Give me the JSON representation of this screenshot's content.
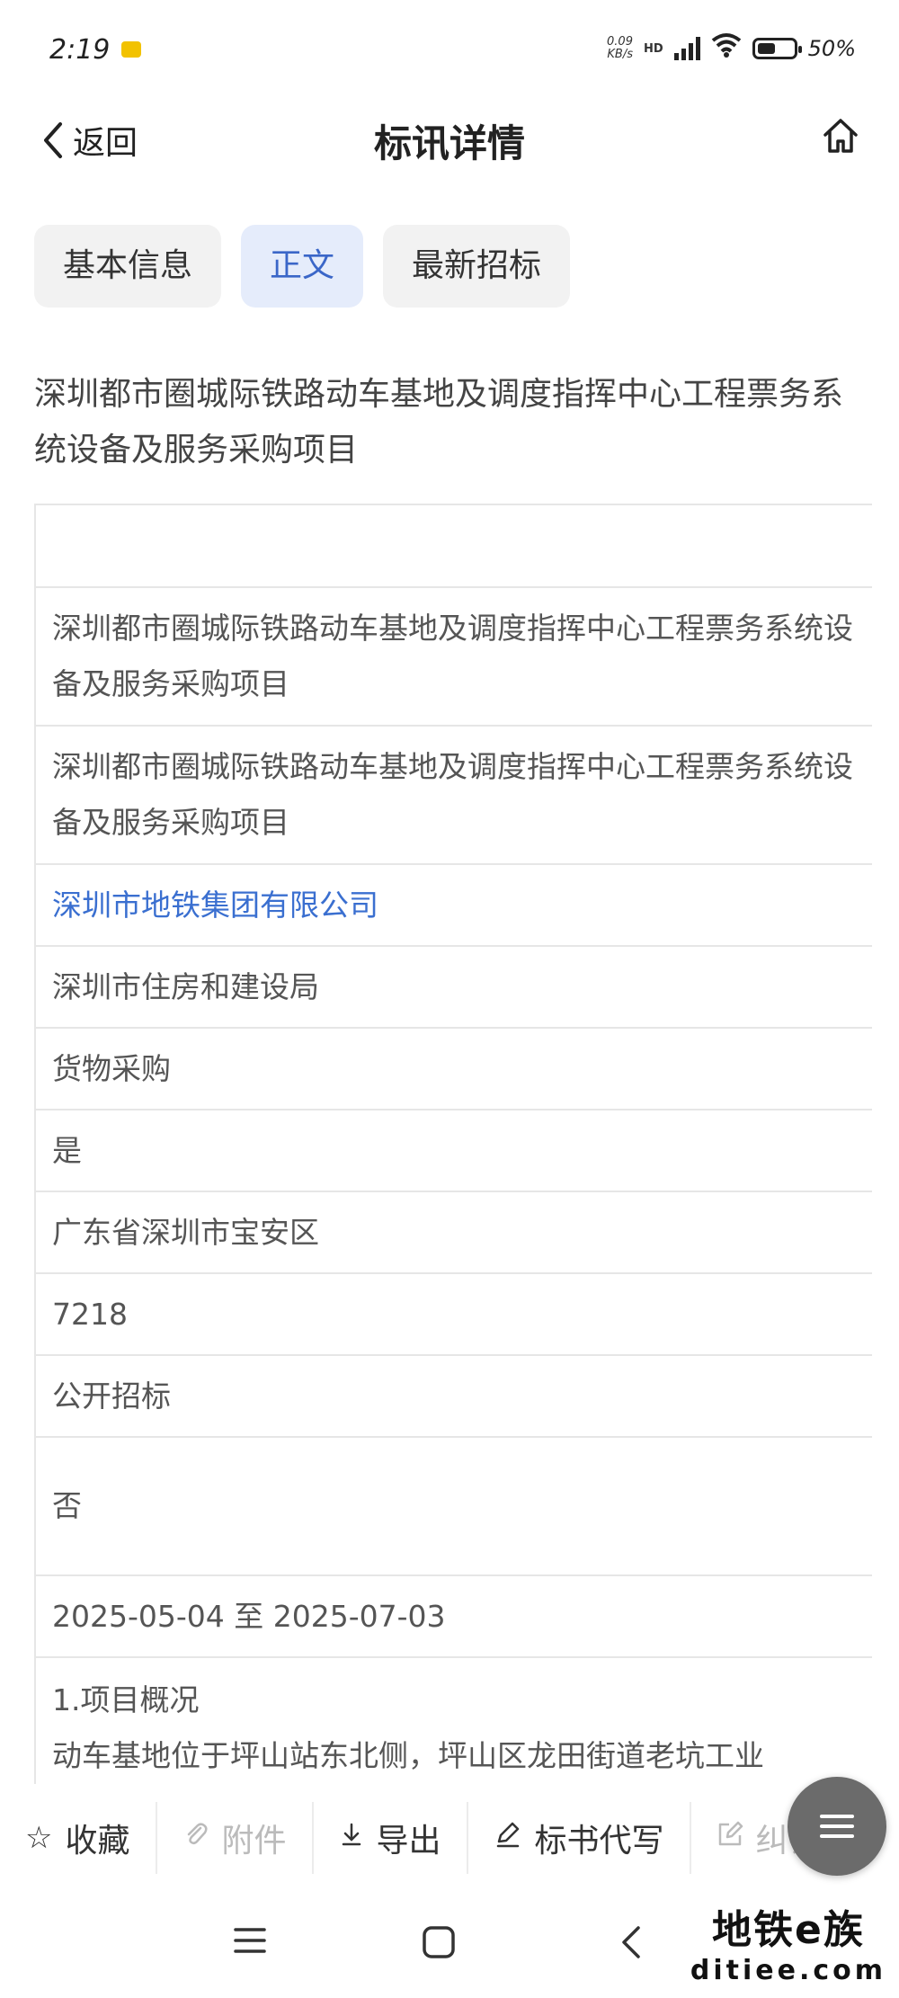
{
  "status_bar": {
    "time": "2:19",
    "speed_value": "0.09",
    "speed_unit": "KB/s",
    "network": "HD",
    "battery_percent": "50%",
    "battery_level": 0.5
  },
  "nav": {
    "back_label": "返回",
    "title": "标讯详情"
  },
  "tabs": [
    {
      "label": "基本信息",
      "active": false
    },
    {
      "label": "正文",
      "active": true
    },
    {
      "label": "最新招标",
      "active": false
    }
  ],
  "headline": "深圳都市圈城际铁路动车基地及调度指挥中心工程票务系统设备及服务采购项目",
  "table_rows": [
    {
      "value": "",
      "link": false
    },
    {
      "value": "深圳都市圈城际铁路动车基地及调度指挥中心工程票务系统设备及服务采购项目",
      "link": false
    },
    {
      "value": "深圳都市圈城际铁路动车基地及调度指挥中心工程票务系统设备及服务采购项目",
      "link": false
    },
    {
      "value": "深圳市地铁集团有限公司",
      "link": true
    },
    {
      "value": "深圳市住房和建设局",
      "link": false
    },
    {
      "value": "货物采购",
      "link": false
    },
    {
      "value": "是",
      "link": false
    },
    {
      "value": "广东省深圳市宝安区",
      "link": false
    },
    {
      "value": "7218",
      "link": false
    },
    {
      "value": "公开招标",
      "link": false
    },
    {
      "value": "否",
      "link": false
    },
    {
      "value": "2025-05-04 至 2025-07-03",
      "link": false
    },
    {
      "value": "1.项目概况\n动车基地位于坪山站东北侧，坪山区龙田街道老坑工业",
      "link": false
    }
  ],
  "bottom_bar": {
    "favorite": "收藏",
    "attachment": "附件",
    "export": "导出",
    "bid_writing": "标书代写",
    "correction_partial": "纠错"
  },
  "watermark": {
    "line1": "地铁e族",
    "line2": "ditiee.com"
  },
  "colors": {
    "accent": "#3a66c8",
    "tab_active_bg": "#e5ecfb",
    "link": "#3a6fd0"
  }
}
